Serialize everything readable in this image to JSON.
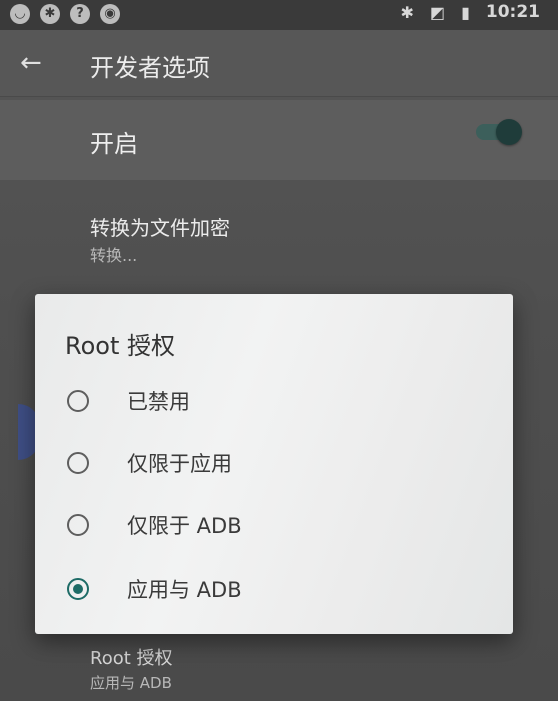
{
  "status_bar": {
    "left_icons": [
      "shield-icon",
      "puzzle-icon",
      "wifi-unknown-icon",
      "record-icon"
    ],
    "right_icons": [
      "bluetooth-icon",
      "no-sim-icon",
      "battery-icon"
    ],
    "time": "10:21"
  },
  "app_bar": {
    "back_icon": "arrow-left-icon",
    "title": "开发者选项"
  },
  "master_switch": {
    "label": "开启",
    "state": "on"
  },
  "settings": {
    "convert": {
      "title": "转换为文件加密",
      "summary": "转换..."
    },
    "root": {
      "title": "Root 授权",
      "summary": "应用与 ADB"
    }
  },
  "dialog": {
    "title": "Root 授权",
    "options": [
      {
        "label": "已禁用",
        "selected": false
      },
      {
        "label": "仅限于应用",
        "selected": false
      },
      {
        "label": "仅限于 ADB",
        "selected": false
      },
      {
        "label": "应用与 ADB",
        "selected": true
      }
    ]
  },
  "colors": {
    "accent": "#1d6b66",
    "dialog_bg": "#efefef"
  }
}
